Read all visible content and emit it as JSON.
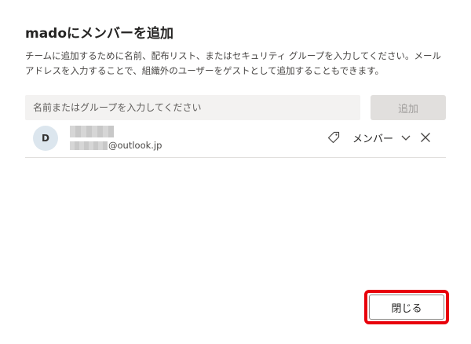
{
  "dialog": {
    "title": "madoにメンバーを追加",
    "description": "チームに追加するために名前、配布リスト、またはセキュリティ グループを入力してください。メールアドレスを入力することで、組織外のユーザーをゲストとして追加することもできます。"
  },
  "search": {
    "placeholder": "名前またはグループを入力してください",
    "value": ""
  },
  "add_button": {
    "label": "追加",
    "enabled": false
  },
  "members": [
    {
      "avatar_initial": "D",
      "email_domain": "@outlook.jp",
      "role": "メンバー",
      "tag_icon": "tag-icon",
      "dropdown_icon": "chevron-down-icon",
      "remove_icon": "close-icon"
    }
  ],
  "footer": {
    "close_label": "閉じる"
  },
  "colors": {
    "highlight": "#e8000b",
    "avatar_bg": "#dce6ee",
    "disabled_button_bg": "#e1dfdd",
    "input_bg": "#f3f2f1"
  }
}
